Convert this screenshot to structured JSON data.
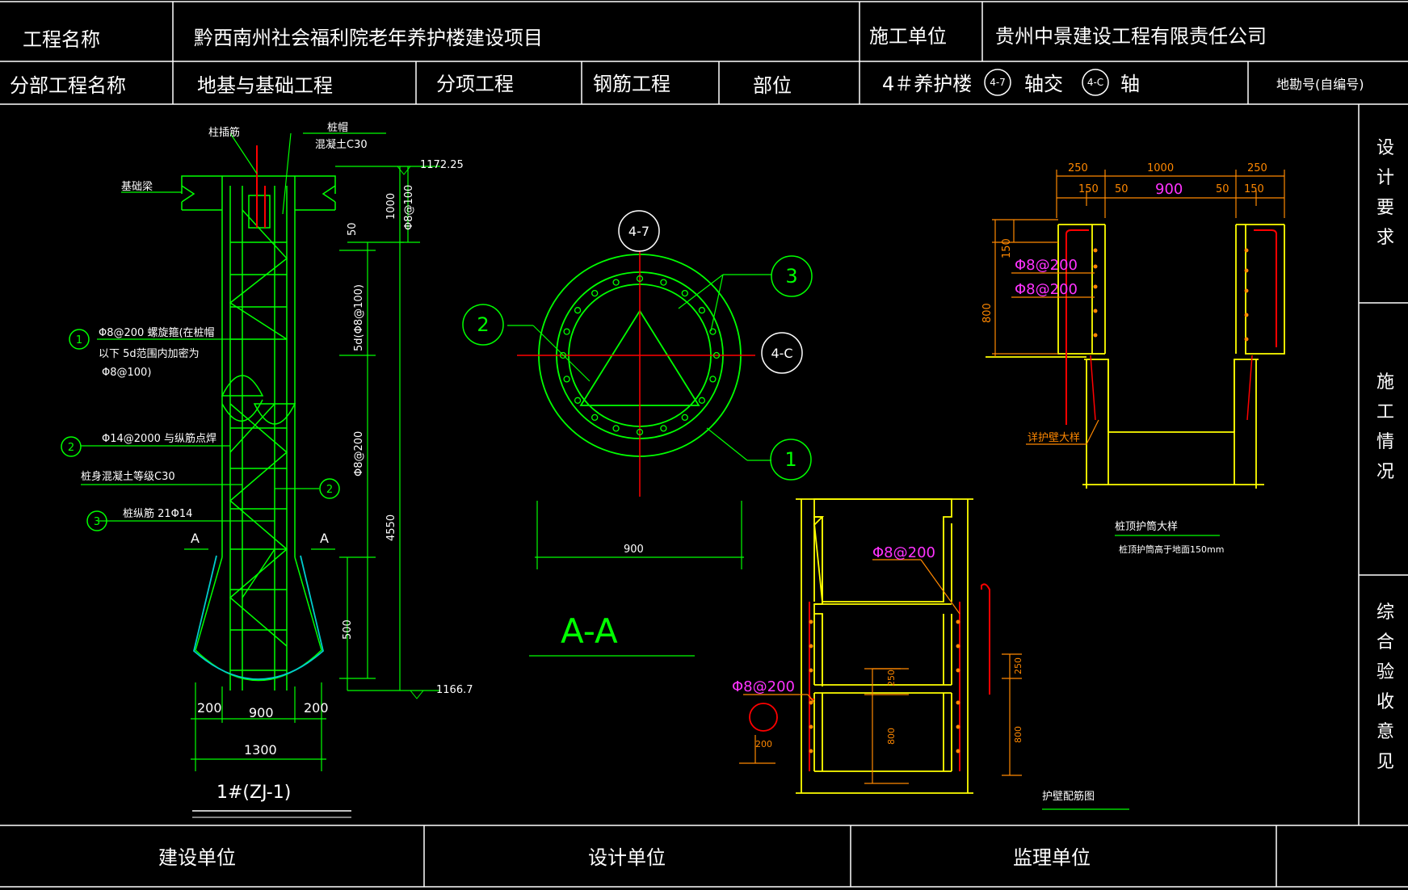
{
  "header": {
    "project_label": "工程名称",
    "project_value": "黔西南州社会福利院老年养护楼建设项目",
    "contractor_label": "施工单位",
    "contractor_value": "贵州中景建设工程有限责任公司",
    "subdivision_label": "分部工程名称",
    "subdivision_value": "地基与基础工程",
    "item_label": "分项工程",
    "item_value": "钢筋工程",
    "part_label": "部位",
    "part_value": "4＃养护楼",
    "axis1": "4-7",
    "axis_join": "轴交",
    "axis2": "4-C",
    "axis_suffix": "轴",
    "drawing_no": "地勘号(自编号)"
  },
  "side": {
    "design": "设计要求",
    "construction": "施工情况",
    "acceptance": "综合验收意见"
  },
  "footer": {
    "owner": "建设单位",
    "designer": "设计单位",
    "supervisor": "监理单位"
  },
  "colors": {
    "green": "#00ff00",
    "yellow": "#ffff00",
    "red": "#ff0000",
    "magenta": "#ff33ff",
    "orange": "#ff8800",
    "cyan": "#00cccc",
    "white": "#ffffff"
  },
  "pile": {
    "col_rebar": "柱插筋",
    "cap": "桩帽",
    "cap_concrete": "混凝土C30",
    "foundation_beam": "基础梁",
    "elev_top": "1172.25",
    "elev_bottom": "1166.7",
    "dim_1000": "1000",
    "dim_phi8_100": "Φ8@100",
    "dim_50": "50",
    "dim_5d": "5d(Φ8@100)",
    "dim_phi8_200": "Φ8@200",
    "dim_4550": "4550",
    "dim_500": "500",
    "callout1_line1": "Φ8@200  螺旋箍(在桩帽",
    "callout1_line2": "以下 5d范围内加密为",
    "callout1_line3": "Φ8@100)",
    "callout2": "Φ14@2000  与纵筋点焊",
    "pile_concrete": "桩身混凝土等级C30",
    "callout3": "桩纵筋   21Φ14",
    "section_a": "A",
    "d200l": "200",
    "d900": "900",
    "d200r": "200",
    "d1300": "1300",
    "title": "1#(ZJ-1)",
    "n1": "1",
    "n2": "2",
    "n3": "3"
  },
  "section": {
    "axis_top": "4-7",
    "axis_right": "4-C",
    "n1": "1",
    "n2": "2",
    "n3": "3",
    "dim900": "900",
    "title": "A-A"
  },
  "collar": {
    "d250a": "250",
    "d1000": "1000",
    "d250b": "250",
    "d150a": "150",
    "d50a": "50",
    "d900": "900",
    "d50b": "50",
    "d150b": "150",
    "d150v": "150",
    "d800": "800",
    "bar1": "Φ8@200",
    "bar2": "Φ8@200",
    "detail_ref": "详护壁大样",
    "title": "桩顶护筒大样",
    "note": "桩顶护筒高于地面150mm"
  },
  "wall": {
    "bar_top": "Φ8@200",
    "bar_left": "Φ8@200",
    "d200": "200",
    "d250a": "250",
    "d800a": "800",
    "d250b": "250",
    "d800b": "800",
    "title": "护壁配筋图"
  }
}
